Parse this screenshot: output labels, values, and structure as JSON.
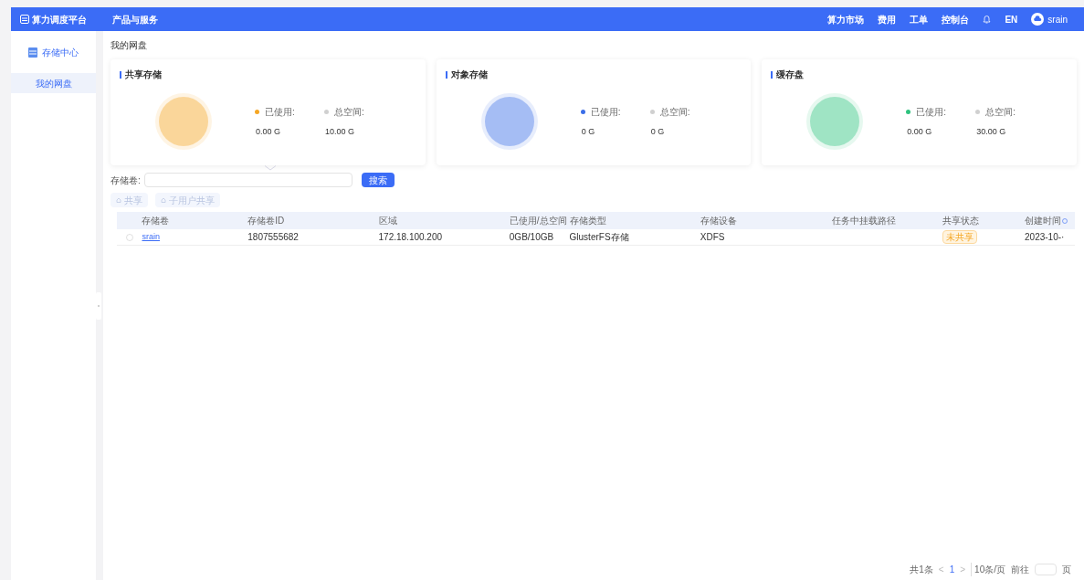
{
  "header": {
    "logo": "算力调度平台",
    "menu": "产品与服务",
    "links": [
      "算力市场",
      "费用",
      "工单",
      "控制台"
    ],
    "language": "EN",
    "user": "srain"
  },
  "sidebar": {
    "title": "存储中心",
    "items": [
      {
        "label": "我的网盘",
        "selected": true
      }
    ]
  },
  "breadcrumb": "我的网盘",
  "cards": [
    {
      "title": "共享存储",
      "color": "#f5a623",
      "used_label": "已使用:",
      "total_label": "总空间:",
      "used": "0.00 G",
      "total": "10.00 G"
    },
    {
      "title": "对象存储",
      "color": "#3a6ee8",
      "used_label": "已使用:",
      "total_label": "总空间:",
      "used": "0 G",
      "total": "0 G"
    },
    {
      "title": "缓存盘",
      "color": "#2ec27e",
      "used_label": "已使用:",
      "total_label": "总空间:",
      "used": "0.00 G",
      "total": "30.00 G"
    }
  ],
  "search": {
    "label": "存储卷:",
    "button": "搜索"
  },
  "actions": [
    {
      "label": "共享",
      "disabled": true
    },
    {
      "label": "子用户共享",
      "disabled": true
    }
  ],
  "table": {
    "columns": [
      "存储卷",
      "存储卷ID",
      "区域",
      "已使用/总空间",
      "存储类型",
      "存储设备",
      "任务中挂载路径",
      "共享状态",
      "创建时间"
    ],
    "rows": [
      {
        "selected": false,
        "cells": [
          "srain",
          "1807555682",
          "172.18.100.200",
          "0GB/10GB",
          "GlusterFS存储",
          "XDFS",
          "",
          "未共享",
          "2023-10-·"
        ]
      }
    ]
  },
  "pagination": {
    "total": "共1条",
    "prev": "<",
    "page": "1",
    "next": ">",
    "size": "10条/页",
    "goto": "前往",
    "unit": "页"
  }
}
